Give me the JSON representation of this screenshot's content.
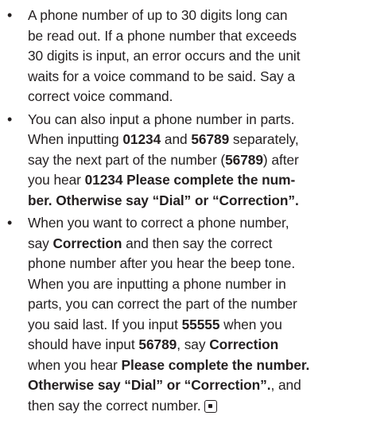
{
  "bullet_char": "•",
  "bullets": [
    {
      "lines": [
        [
          {
            "t": "A phone number of up to 30 digits long can"
          }
        ],
        [
          {
            "t": "be read out. If a phone number that exceeds"
          }
        ],
        [
          {
            "t": "30 digits is input, an error occurs and the unit"
          }
        ],
        [
          {
            "t": "waits for a voice command to be said. Say a"
          }
        ],
        [
          {
            "t": "correct voice command."
          }
        ]
      ]
    },
    {
      "lines": [
        [
          {
            "t": "You can also input a phone number in parts."
          }
        ],
        [
          {
            "t": "When inputting "
          },
          {
            "t": "01234",
            "b": true
          },
          {
            "t": " and "
          },
          {
            "t": "56789",
            "b": true
          },
          {
            "t": " separately,"
          }
        ],
        [
          {
            "t": "say the next part of the number ("
          },
          {
            "t": "56789",
            "b": true
          },
          {
            "t": ") after"
          }
        ],
        [
          {
            "t": "you hear "
          },
          {
            "t": "01234 Please complete the num-",
            "b": true
          }
        ],
        [
          {
            "t": "ber. Otherwise say “Dial” or “Correction”.",
            "b": true
          }
        ]
      ]
    },
    {
      "lines": [
        [
          {
            "t": "When you want to correct a phone number,"
          }
        ],
        [
          {
            "t": "say "
          },
          {
            "t": "Correction",
            "b": true
          },
          {
            "t": " and then say the correct"
          }
        ],
        [
          {
            "t": "phone number after you hear the beep tone."
          }
        ],
        [
          {
            "t": "When you are inputting a phone number in"
          }
        ],
        [
          {
            "t": "parts, you can correct the part of the number"
          }
        ],
        [
          {
            "t": "you said last. If you input "
          },
          {
            "t": "55555",
            "b": true
          },
          {
            "t": " when you"
          }
        ],
        [
          {
            "t": "should have input "
          },
          {
            "t": "56789",
            "b": true
          },
          {
            "t": ", say "
          },
          {
            "t": "Correction",
            "b": true
          }
        ],
        [
          {
            "t": "when you hear "
          },
          {
            "t": "Please complete the number.",
            "b": true
          }
        ],
        [
          {
            "t": "Otherwise say “Dial” or “Correction”.",
            "b": true
          },
          {
            "t": ", and"
          }
        ],
        [
          {
            "t": "then say the correct number."
          }
        ]
      ],
      "end_mark_icon": "end-of-section-mark-icon"
    }
  ]
}
